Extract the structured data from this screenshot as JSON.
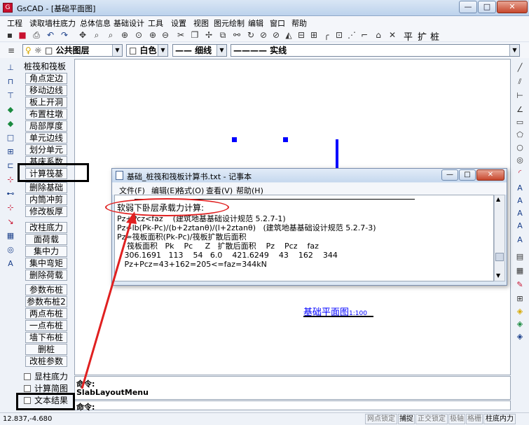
{
  "app": {
    "title": "GsCAD - [基础平面图]",
    "logo_text": "G",
    "window_buttons": {
      "minimize": "—",
      "maximize": "□",
      "close": "✕"
    }
  },
  "menubar": {
    "items": [
      "工程",
      "读取墙柱底力",
      "总体信息",
      "基础设计",
      "工具",
      "设置",
      "视图",
      "图元绘制",
      "编辑",
      "窗口",
      "帮助"
    ]
  },
  "toolbar1": {
    "text_tools": [
      "平",
      "扩",
      "桩"
    ]
  },
  "toolbar2": {
    "layer": "公共图层",
    "color": "白色",
    "linestyle": "—— 细线",
    "linetype": "———— 实线"
  },
  "panel": {
    "title": "桩筏和筏板",
    "buttons": [
      "角点定边",
      "移动边线",
      "板上开洞",
      "布置柱墩",
      "局部厚度",
      "单元边线",
      "划分单元",
      "基床系数",
      "计算筏基",
      "删除基础",
      "内筒冲剪",
      "修改板厚",
      "改柱底力",
      "面荷载",
      "集中力",
      "集中弯矩",
      "删除荷载",
      "参数布桩",
      "参数布桩2",
      "两点布桩",
      "一点布桩",
      "墙下布桩",
      "删桩",
      "改桩参数"
    ],
    "checks": [
      "显柱底力",
      "计算简图",
      "文本结果"
    ]
  },
  "canvas": {
    "plan_label": "基础平面图",
    "plan_scale": "1:100"
  },
  "notepad": {
    "title": "基础_桩筏和筏板计算书.txt - 记事本",
    "menus": [
      "文件(F)",
      "编辑(E)",
      "格式(O)",
      "查看(V)",
      "帮助(H)"
    ],
    "lines": [
      "软弱下卧层承载力计算:",
      "Pz+Pcz<faz    (建筑地基基础设计规范 5.2.7-1)",
      "Pz=lb(Pk-Pc)/(b+2ztanθ)/(l+2ztanθ)   (建筑地基基础设计规范 5.2.7-3)",
      "Pz=筏板面积(Pk-Pc)/筏板扩散后面积",
      "    筏板面积   Pk    Pc     Z   扩散后面积    Pz    Pcz    faz",
      "   306.1691   113    54   6.0    421.6249    43    162    344",
      "   Pz+Pcz=43+162=205<=faz=344kN"
    ]
  },
  "command": {
    "line1": "命令:",
    "line2": "SlabLayoutMenu",
    "prompt": "命令:"
  },
  "statusbar": {
    "coords": "12.837,-4.680",
    "cells": [
      "网点锁定",
      "捕捉",
      "正交锁定",
      "极轴",
      "格栅",
      "柱底内力"
    ]
  },
  "colors": {
    "accent_blue": "#0000ff",
    "highlight_red": "#e02020",
    "annotation_black": "#000000"
  }
}
